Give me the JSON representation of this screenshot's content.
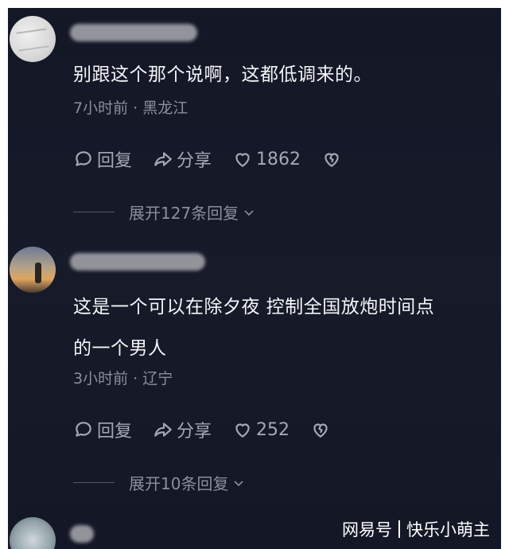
{
  "comments": [
    {
      "text": "别跟这个那个说啊，这都低调来的。",
      "meta": "7小时前 · 黑龙江",
      "reply_label": "回复",
      "share_label": "分享",
      "like_count": "1862",
      "expand_label": "展开127条回复"
    },
    {
      "text": "这是一个可以在除夕夜 控制全国放炮时间点\n的一个男人",
      "meta": "3小时前 · 辽宁",
      "reply_label": "回复",
      "share_label": "分享",
      "like_count": "252",
      "expand_label": "展开10条回复"
    }
  ],
  "watermark": {
    "source": "网易号",
    "author": "快乐小萌主"
  },
  "icons": {
    "reply": "comment-bubble-icon",
    "share": "share-arrow-icon",
    "like": "heart-icon",
    "dislike": "broken-heart-icon",
    "expand": "chevron-down-icon"
  },
  "colors": {
    "background": "#151927",
    "text": "#f4f5f8",
    "meta": "#8b8f9b",
    "action": "#a4a8b3"
  }
}
